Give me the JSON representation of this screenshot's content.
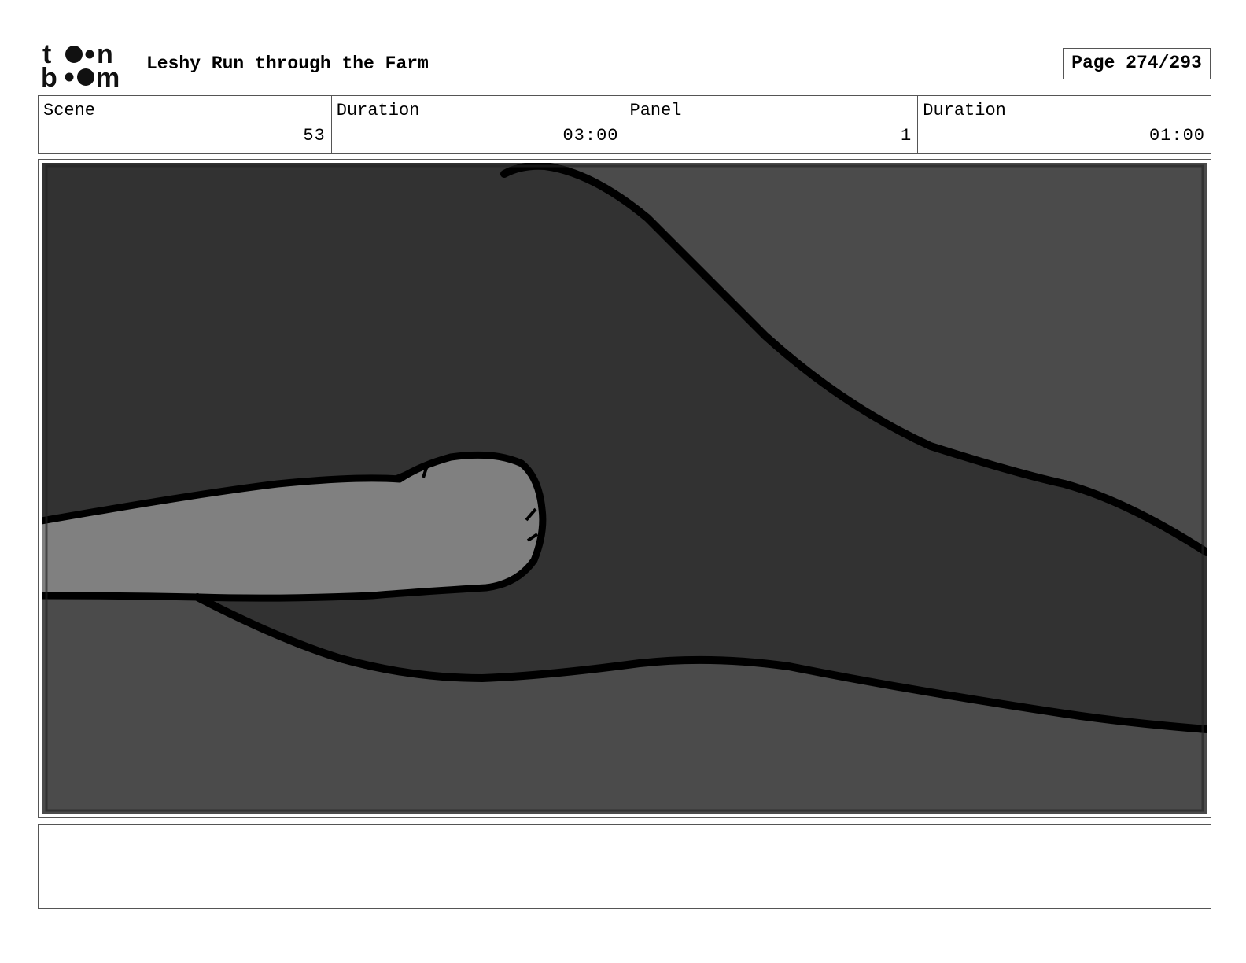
{
  "header": {
    "logo_text": "toon boom",
    "title": "Leshy Run through the Farm",
    "page_label": "Page 274/293"
  },
  "info": [
    {
      "label": "Scene",
      "value": "53"
    },
    {
      "label": "Duration",
      "value": "03:00"
    },
    {
      "label": "Panel",
      "value": "1"
    },
    {
      "label": "Duration",
      "value": "01:00"
    }
  ],
  "panel": {
    "colors": {
      "background": "#4b4b4b",
      "shadow": "#323232",
      "finger": "#808080",
      "outline": "#000000"
    }
  },
  "notes": {
    "text": ""
  }
}
